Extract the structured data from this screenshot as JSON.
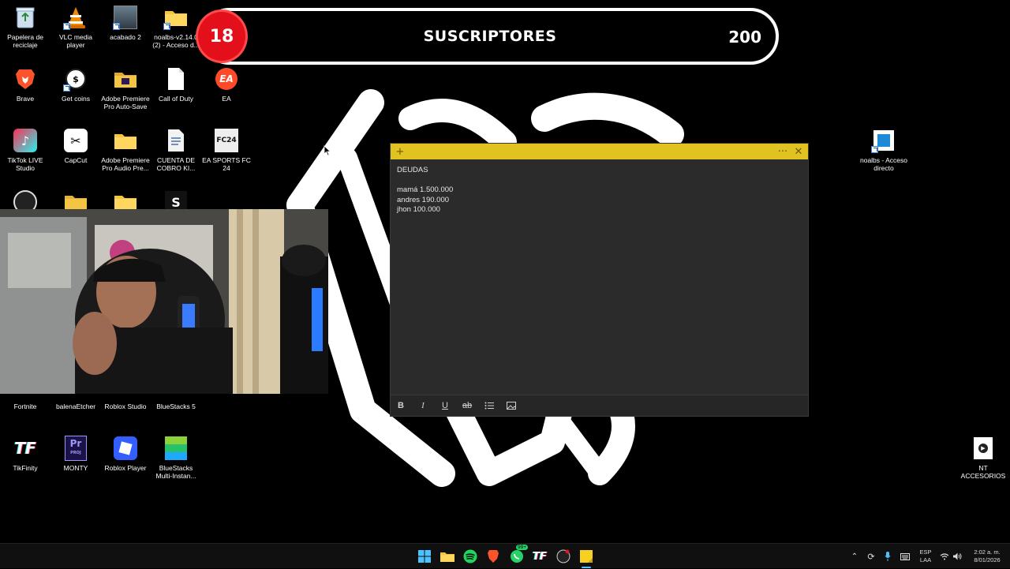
{
  "subscriber_widget": {
    "current": "18",
    "title": "SUSCRIPTORES",
    "goal": "200"
  },
  "desktop_icons": [
    {
      "id": "recycle",
      "label": "Papelera de reciclaje",
      "icon": "recycle-bin-icon"
    },
    {
      "id": "vlc",
      "label": "VLC media player",
      "icon": "vlc-icon"
    },
    {
      "id": "acabado",
      "label": "acabado 2",
      "icon": "image-file-icon"
    },
    {
      "id": "noalbs-folder",
      "label": "noalbs-v2.14.0 (2) - Acceso d...",
      "icon": "folder-icon"
    },
    {
      "id": "brave",
      "label": "Brave",
      "icon": "brave-icon"
    },
    {
      "id": "getcoins",
      "label": "Get coins",
      "icon": "tiktok-coins-icon"
    },
    {
      "id": "premiere-autosave",
      "label": "Adobe Premiere Pro Auto-Save",
      "icon": "folder-icon"
    },
    {
      "id": "callofduty",
      "label": "Call of Duty",
      "icon": "file-icon"
    },
    {
      "id": "ea",
      "label": "EA",
      "icon": "ea-icon"
    },
    {
      "id": "tiktoklive",
      "label": "TikTok LIVE Studio",
      "icon": "tiktok-live-icon"
    },
    {
      "id": "capcut",
      "label": "CapCut",
      "icon": "capcut-icon"
    },
    {
      "id": "premiere-audio",
      "label": "Adobe Premiere Pro Audio Pre...",
      "icon": "folder-icon"
    },
    {
      "id": "cuenta",
      "label": "CUENTA DE COBRO KI...",
      "icon": "document-icon"
    },
    {
      "id": "fc24",
      "label": "EA SPORTS FC 24",
      "icon": "fc24-icon"
    },
    {
      "id": "noalbs-right",
      "label": "noalbs - Acceso directo",
      "icon": "app-icon"
    },
    {
      "id": "fortnite",
      "label": "Fortnite",
      "icon": "fortnite-icon"
    },
    {
      "id": "balena",
      "label": "balenaEtcher",
      "icon": "balena-icon"
    },
    {
      "id": "robloxstudio",
      "label": "Roblox Studio",
      "icon": "roblox-studio-icon"
    },
    {
      "id": "bluestacks5",
      "label": "BlueStacks 5",
      "icon": "bluestacks-icon"
    },
    {
      "id": "tikfinity",
      "label": "TikFinity",
      "icon": "tikfinity-icon"
    },
    {
      "id": "monty",
      "label": "MONTY",
      "icon": "premiere-project-icon"
    },
    {
      "id": "robloxplayer",
      "label": "Roblox Player",
      "icon": "roblox-icon"
    },
    {
      "id": "bluestacks-multi",
      "label": "BlueStacks Multi-Instan...",
      "icon": "bluestacks-multi-icon"
    },
    {
      "id": "ntaccesorios",
      "label": "NT ACCESORIOS",
      "icon": "media-file-icon"
    }
  ],
  "sticky_note": {
    "title_line": "DEUDAS",
    "lines": [
      "mamá 1.500.000",
      "andres 190.000",
      "jhon 100.000"
    ],
    "toolbar": {
      "bold": "B",
      "italic": "I",
      "underline": "U",
      "strike": "ab"
    }
  },
  "taskbar": {
    "language_1": "ESP",
    "language_2": "LAA",
    "time": "2:02 a. m.",
    "date": "8/01/2026",
    "whatsapp_badge": "99+"
  }
}
